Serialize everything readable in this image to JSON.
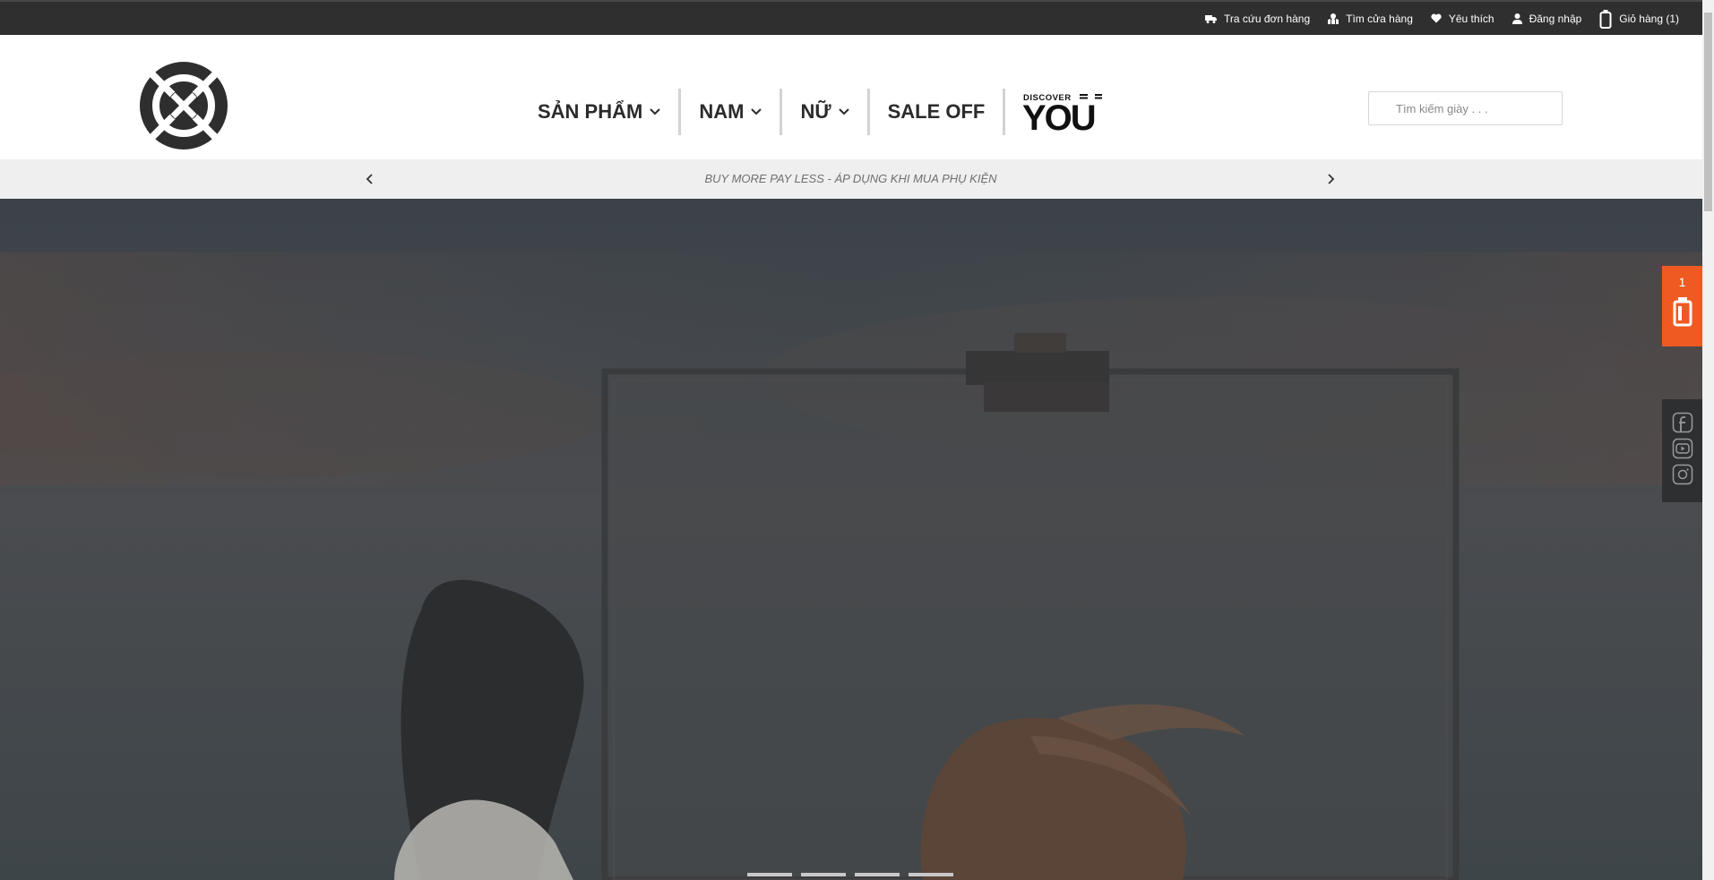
{
  "topbar": {
    "links": [
      {
        "label": "Tra cứu đơn hàng",
        "icon": "truck-icon"
      },
      {
        "label": "Tìm cửa hàng",
        "icon": "map-icon"
      },
      {
        "label": "Yêu thích",
        "icon": "heart-icon"
      },
      {
        "label": "Đăng nhập",
        "icon": "user-icon"
      },
      {
        "label": "Giỏ hàng (1)",
        "icon": "bag-icon"
      }
    ]
  },
  "header": {
    "nav": [
      {
        "label": "SẢN PHẨM",
        "dropdown": true
      },
      {
        "label": "NAM",
        "dropdown": true
      },
      {
        "label": "NỮ",
        "dropdown": true
      },
      {
        "label": "SALE OFF",
        "dropdown": false
      }
    ],
    "discover_small": "DISCOVER",
    "discover_big": "YOU",
    "search_placeholder": "Tìm kiếm giày . . ."
  },
  "promo": {
    "text": "BUY MORE PAY LESS - ÁP DỤNG KHI MUA PHỤ KIỆN"
  },
  "hero": {
    "slide_count": 4
  },
  "float_cart": {
    "count": "1"
  },
  "colors": {
    "topbar": "#2f2f2f",
    "accent": "#ef5a23",
    "promo_bg": "#efefef"
  }
}
